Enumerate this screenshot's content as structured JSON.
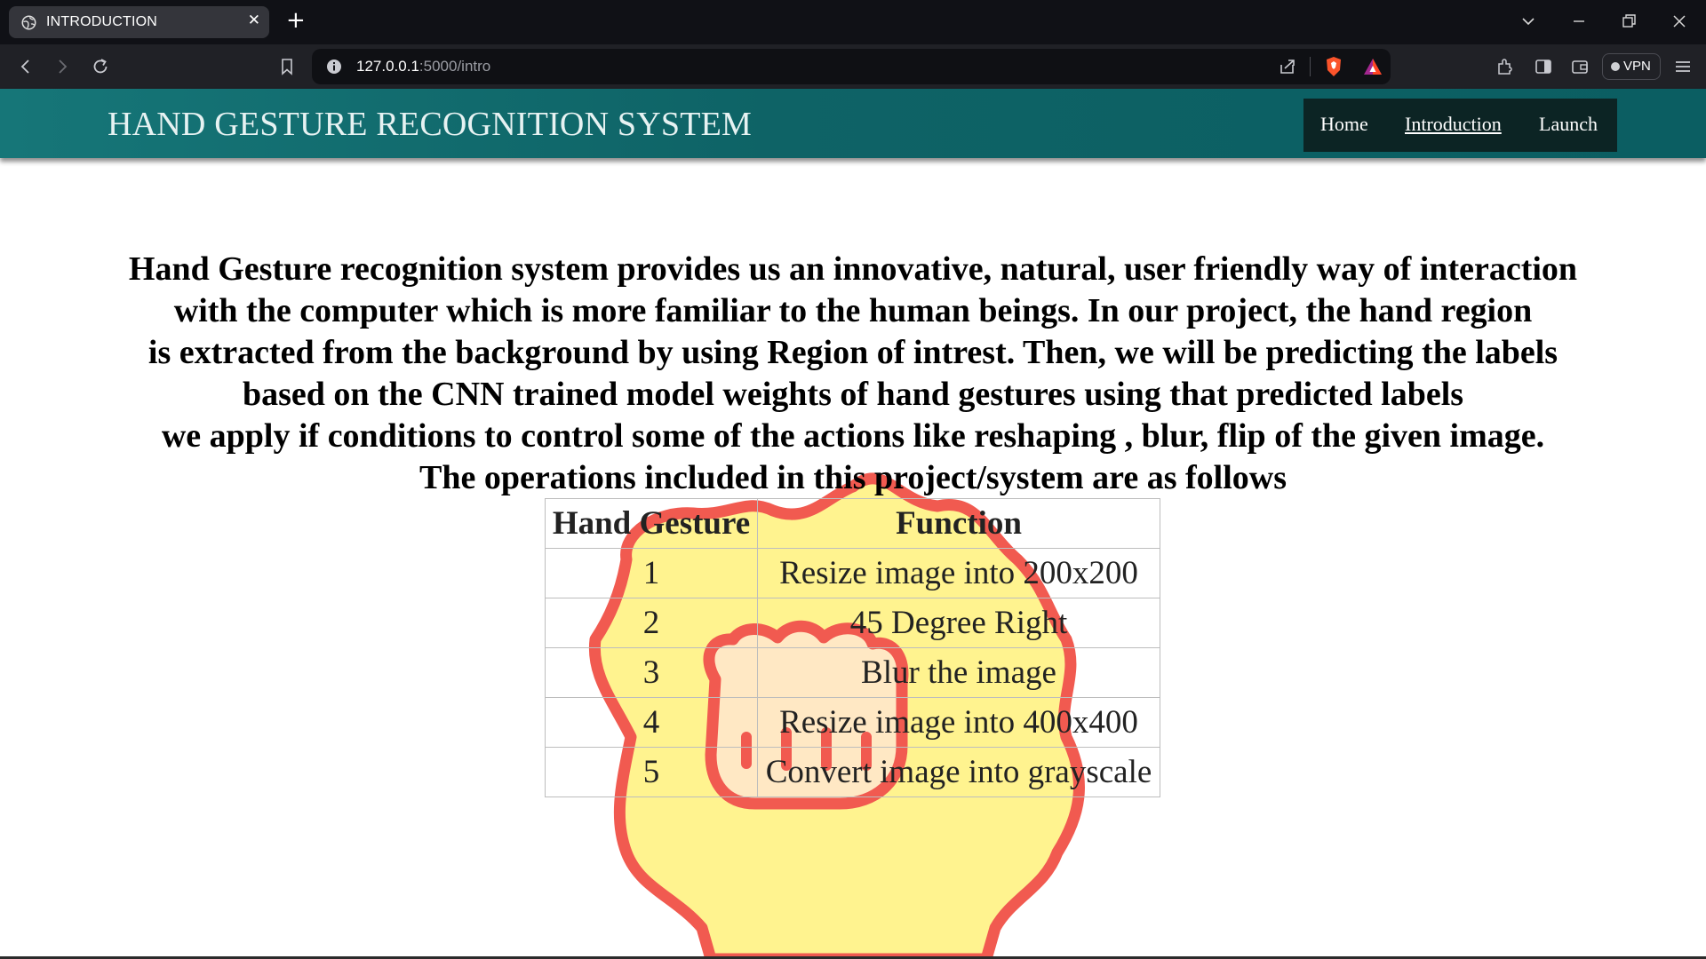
{
  "browser": {
    "tab_title": "INTRODUCTION",
    "close_symbol": "✕",
    "new_tab_symbol": "+",
    "url_host": "127.0.0.1",
    "url_path": ":5000/intro",
    "vpn_label": "VPN"
  },
  "site": {
    "title": "HAND GESTURE RECOGNITION SYSTEM",
    "nav": {
      "home": "Home",
      "introduction": "Introduction",
      "launch": "Launch"
    }
  },
  "intro": {
    "lines": [
      "Hand Gesture recognition system provides us an innovative, natural, user friendly way of interaction",
      "with the computer which is more familiar to the human beings. In our project, the hand region",
      "is extracted from the background by using Region of intrest. Then, we will be predicting the labels",
      "based on the CNN trained model weights of hand gestures using that predicted labels",
      "we apply if conditions to control some of the actions like reshaping , blur, flip of the given image.",
      "The operations included in this project/system are as follows"
    ]
  },
  "table": {
    "headers": {
      "gesture": "Hand Gesture",
      "function": "Function"
    },
    "rows": [
      {
        "gesture": "1",
        "function": "Resize image into 200x200"
      },
      {
        "gesture": "2",
        "function": "45 Degree Right"
      },
      {
        "gesture": "3",
        "function": "Blur the image"
      },
      {
        "gesture": "4",
        "function": "Resize image into 400x400"
      },
      {
        "gesture": "5",
        "function": "Convert image into grayscale"
      }
    ]
  },
  "icons": {
    "tab": "globe-icon",
    "sticker": "fist-badge-icon"
  },
  "colors": {
    "header_teal": "#0e6366",
    "nav_dark": "#0c2424",
    "sticker_fill": "#fff38f",
    "sticker_stroke": "#f15a50"
  }
}
